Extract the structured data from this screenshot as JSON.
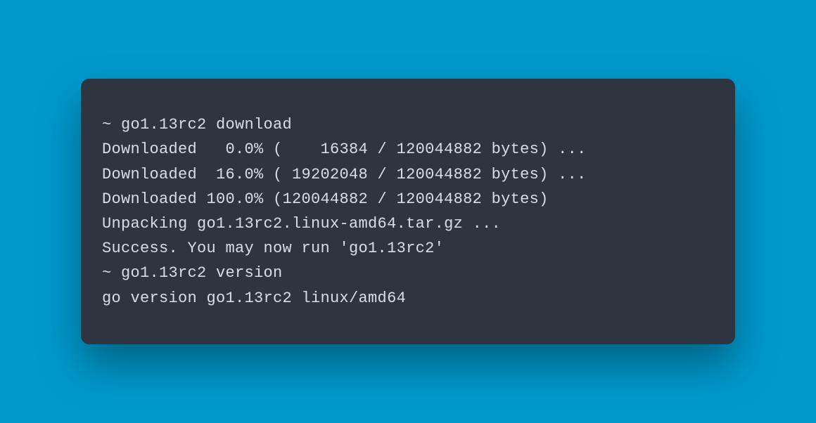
{
  "terminal": {
    "lines": [
      "~ go1.13rc2 download",
      "Downloaded   0.0% (    16384 / 120044882 bytes) ...",
      "Downloaded  16.0% ( 19202048 / 120044882 bytes) ...",
      "Downloaded 100.0% (120044882 / 120044882 bytes)",
      "Unpacking go1.13rc2.linux-amd64.tar.gz ...",
      "Success. You may now run 'go1.13rc2'",
      "~ go1.13rc2 version",
      "go version go1.13rc2 linux/amd64"
    ]
  },
  "colors": {
    "background": "#0099cc",
    "terminal_bg": "#2e3440",
    "terminal_text": "#d8dee9"
  }
}
